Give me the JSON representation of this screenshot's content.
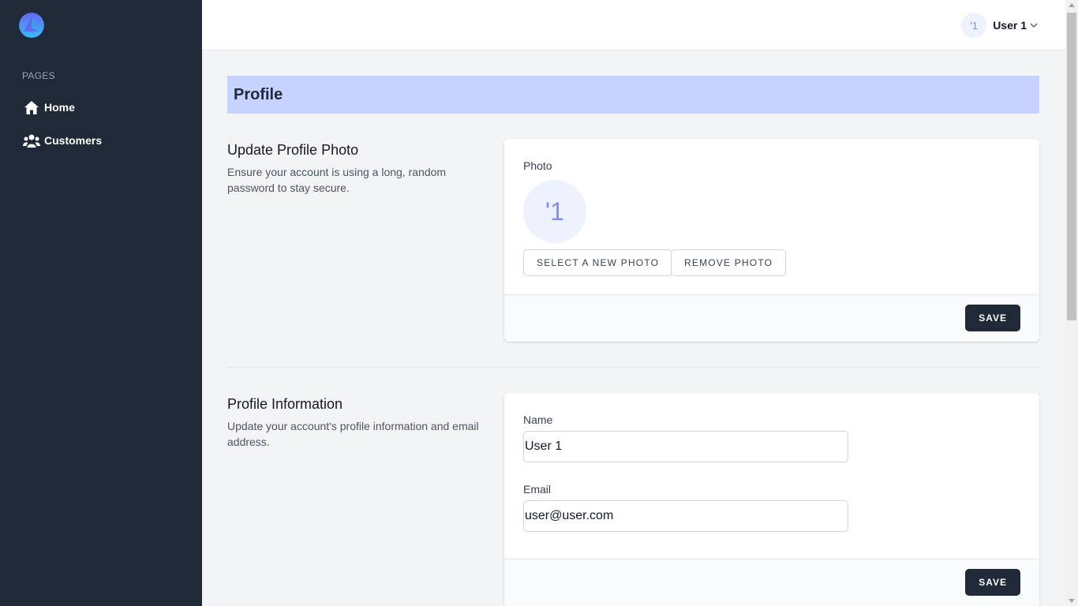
{
  "sidebar": {
    "section_label": "PAGES",
    "items": [
      {
        "label": "Home",
        "icon": "home-icon"
      },
      {
        "label": "Customers",
        "icon": "users-icon"
      }
    ]
  },
  "topbar": {
    "avatar_initials": "'1",
    "user_name": "User 1",
    "dropdown_icon": "chevron-down-icon"
  },
  "page": {
    "title": "Profile"
  },
  "photo_section": {
    "title": "Update Profile Photo",
    "description": "Ensure your account is using a long, random password to stay secure.",
    "photo_label": "Photo",
    "avatar_initials": "'1",
    "select_button": "Select A New Photo",
    "remove_button": "Remove Photo",
    "save_button": "SAVE"
  },
  "info_section": {
    "title": "Profile Information",
    "description": "Update your account's profile information and email address.",
    "name_label": "Name",
    "name_value": "User 1",
    "email_label": "Email",
    "email_value": "user@user.com",
    "save_button": "SAVE"
  },
  "colors": {
    "sidebar_bg": "#1f2937",
    "header_band": "#c7d2fe",
    "page_bg": "#f3f4f6",
    "button_dark": "#1f2937"
  }
}
